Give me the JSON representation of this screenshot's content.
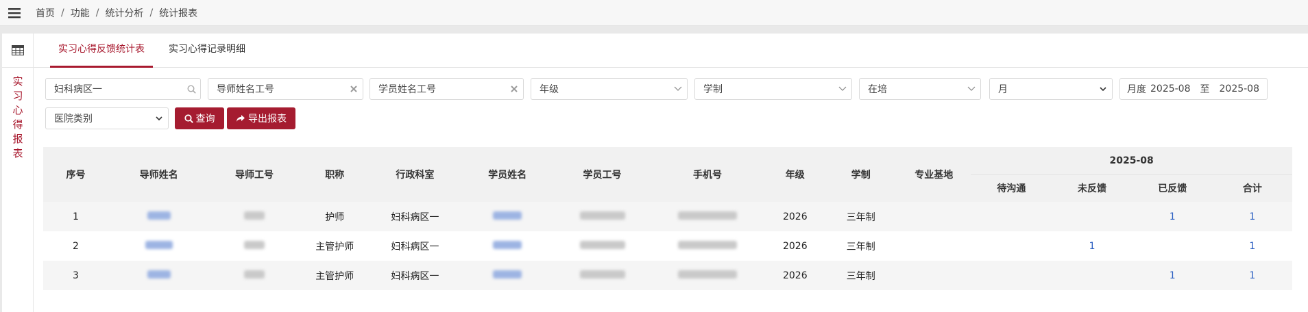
{
  "breadcrumb": [
    "首页",
    "功能",
    "统计分析",
    "统计报表"
  ],
  "sidebar_label": [
    "实",
    "习",
    "心",
    "得",
    "报",
    "表"
  ],
  "tabs": [
    {
      "label": "实习心得反馈统计表",
      "active": true
    },
    {
      "label": "实习心得记录明细",
      "active": false
    }
  ],
  "filters": {
    "department": "妇科病区一",
    "mentor": "导师姓名工号",
    "student": "学员姓名工号",
    "grade": "年级",
    "system": "学制",
    "status": "在培",
    "period": "月",
    "month_label": "月度",
    "month_from": "2025-08",
    "month_to_label": "至",
    "month_to": "2025-08",
    "hospital_type": "医院类别"
  },
  "buttons": {
    "search": "查询",
    "export": "导出报表"
  },
  "table": {
    "headers": {
      "index": "序号",
      "mentor_name": "导师姓名",
      "mentor_id": "导师工号",
      "title": "职称",
      "department": "行政科室",
      "student_name": "学员姓名",
      "student_id": "学员工号",
      "phone": "手机号",
      "grade": "年级",
      "system": "学制",
      "base": "专业基地",
      "month_group": "2025-08",
      "pending": "待沟通",
      "no_feedback": "未反馈",
      "fed_back": "已反馈",
      "total": "合计"
    },
    "rows": [
      {
        "index": "1",
        "title": "护师",
        "department": "妇科病区一",
        "grade": "2026",
        "system": "三年制",
        "base": "",
        "pending": "",
        "no_feedback": "",
        "fed_back": "1",
        "total": "1"
      },
      {
        "index": "2",
        "title": "主管护师",
        "department": "妇科病区一",
        "grade": "2026",
        "system": "三年制",
        "base": "",
        "pending": "",
        "no_feedback": "1",
        "fed_back": "",
        "total": "1"
      },
      {
        "index": "3",
        "title": "主管护师",
        "department": "妇科病区一",
        "grade": "2026",
        "system": "三年制",
        "base": "",
        "pending": "",
        "no_feedback": "",
        "fed_back": "1",
        "total": "1"
      }
    ]
  },
  "colors": {
    "accent": "#a8192e",
    "link": "#2b5fc2"
  }
}
